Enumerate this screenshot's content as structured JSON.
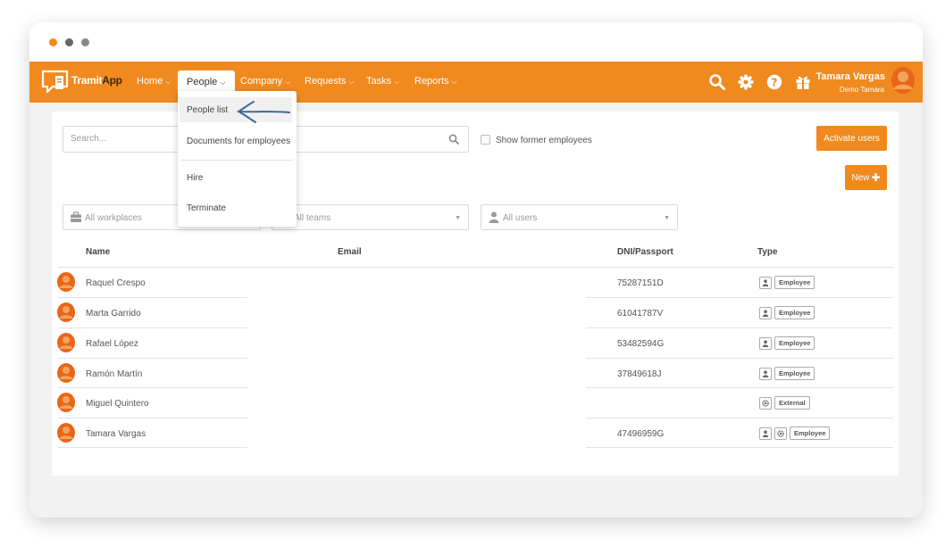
{
  "colors": {
    "brand_orange": "#f08a1f",
    "brand_dark": "#3a2a10"
  },
  "brand": {
    "name_part1": "Tramit",
    "name_part2": "App"
  },
  "nav": {
    "items": [
      {
        "label": "Home"
      },
      {
        "label": "People"
      },
      {
        "label": "Company"
      },
      {
        "label": "Requests"
      },
      {
        "label": "Tasks"
      },
      {
        "label": "Reports"
      }
    ],
    "icons": [
      "search-icon",
      "gear-icon",
      "help-icon",
      "gift-icon"
    ]
  },
  "user": {
    "name": "Tamara Vargas",
    "company": "Demo Tamara"
  },
  "people_menu": {
    "items": [
      {
        "label": "People list"
      },
      {
        "label": "Documents for employees"
      },
      {
        "label": "Hire"
      },
      {
        "label": "Terminate"
      }
    ]
  },
  "toolbar": {
    "search_placeholder": "Search...",
    "show_former_label": "Show former employees",
    "activate_label": "Activate users",
    "new_label": "New"
  },
  "filters": {
    "workplaces": "All workplaces",
    "teams": "All teams",
    "users": "All users"
  },
  "table": {
    "columns": [
      "Name",
      "Email",
      "DNI/Passport",
      "Type"
    ],
    "rows": [
      {
        "name": "Raquel Crespo",
        "email": "",
        "dni": "75287151D",
        "type_icons": [
          "user-icon"
        ],
        "type": "Employee"
      },
      {
        "name": "Marta Garrido",
        "email": "",
        "dni": "61041787V",
        "type_icons": [
          "user-icon"
        ],
        "type": "Employee"
      },
      {
        "name": "Rafael López",
        "email": "",
        "dni": "53482594G",
        "type_icons": [
          "user-icon"
        ],
        "type": "Employee"
      },
      {
        "name": "Ramón Martín",
        "email": "",
        "dni": "37849618J",
        "type_icons": [
          "user-icon"
        ],
        "type": "Employee"
      },
      {
        "name": "Miguel Quintero",
        "email": "",
        "dni": "",
        "type_icons": [
          "gear-icon"
        ],
        "type": "External"
      },
      {
        "name": "Tamara Vargas",
        "email": "",
        "dni": "47496959G",
        "type_icons": [
          "user-icon",
          "gear-icon"
        ],
        "type": "Employee"
      }
    ]
  }
}
